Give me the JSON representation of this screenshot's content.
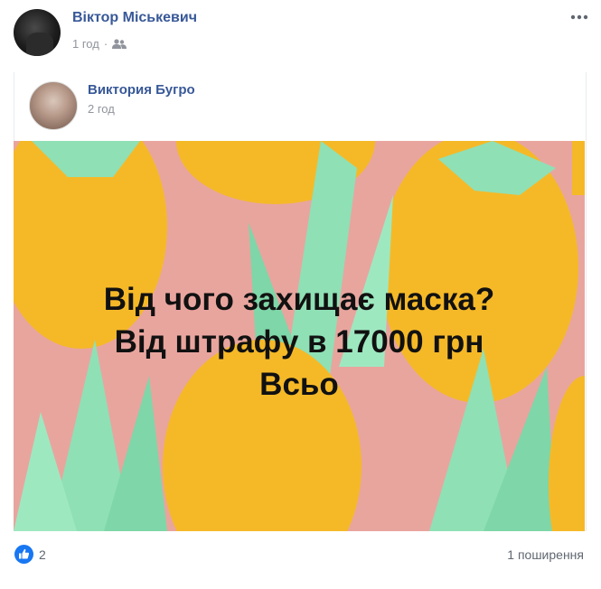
{
  "post": {
    "author": "Віктор Міськевич",
    "time": "1 год",
    "separator": "·",
    "audience_icon": "friends-icon",
    "menu_icon": "more-options-icon"
  },
  "shared_post": {
    "author": "Виктория Бугро",
    "time": "2 год",
    "image_text": {
      "line1": "Від чого захищає маска?",
      "line2": "Від штрафу в 17000 грн",
      "line3": "Всьо"
    },
    "colors": {
      "background": "#e8a59e",
      "pineapple": "#f5b928",
      "leaves": "#8fe0b5"
    }
  },
  "footer": {
    "reaction_icon": "like-icon",
    "reaction_count": "2",
    "shares": "1 поширення"
  }
}
